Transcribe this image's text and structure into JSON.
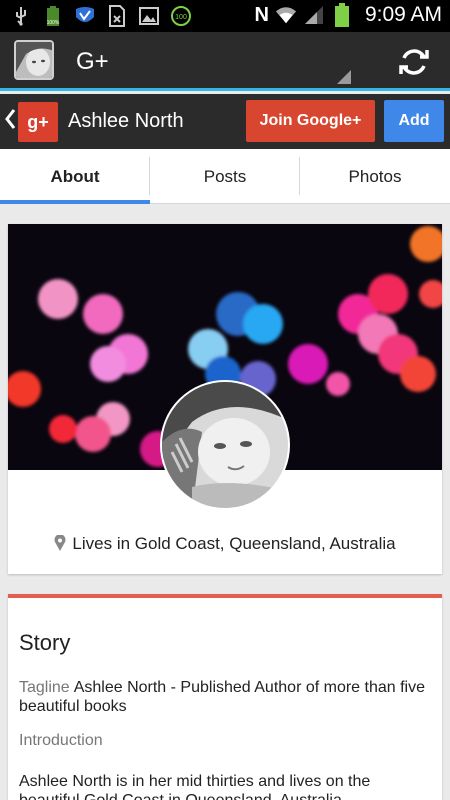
{
  "status_bar": {
    "time": "9:09 AM",
    "network_letter": "N",
    "battery_percent_label": "100%",
    "icons": [
      "usb-icon",
      "battery-widget-icon",
      "sync-badge-icon",
      "sim-missing-icon",
      "image-icon",
      "battery-100-icon",
      "nfc-icon",
      "wifi-icon",
      "signal-icon",
      "battery-icon"
    ]
  },
  "action_bar": {
    "title": "G+"
  },
  "profile_bar": {
    "brand_glyph": "g+",
    "name": "Ashlee North",
    "join_label": "Join Google+",
    "add_label": "Add"
  },
  "tabs": [
    {
      "label": "About",
      "active": true
    },
    {
      "label": "Posts",
      "active": false
    },
    {
      "label": "Photos",
      "active": false
    }
  ],
  "profile": {
    "location": "Lives in Gold Coast, Queensland, Australia"
  },
  "story": {
    "title": "Story",
    "tagline_label": "Tagline",
    "tagline_text": "Ashlee North - Published Author of more than five beautiful books",
    "intro_label": "Introduction",
    "intro_text": "Ashlee North is in her mid thirties and lives on the beautiful Gold Coast in Queensland, Australia."
  },
  "colors": {
    "accent_blue": "#3f87e8",
    "google_red": "#d9462f",
    "holo_blue": "#33b5e5",
    "story_accent": "#e15f4f"
  }
}
